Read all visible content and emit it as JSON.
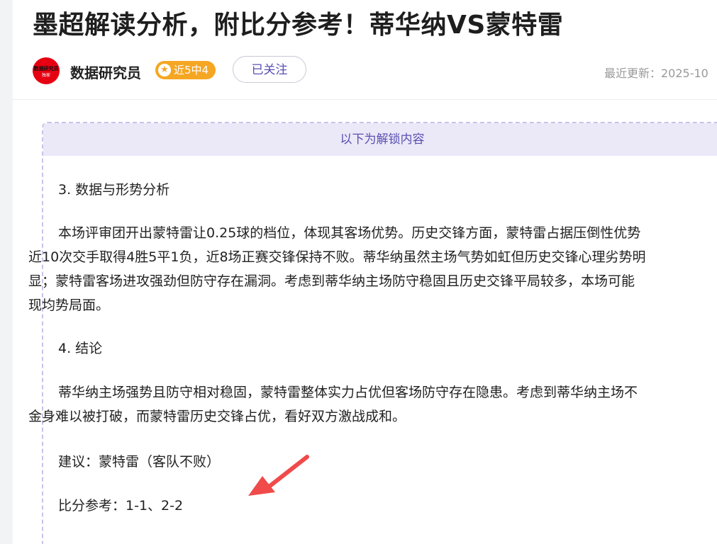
{
  "article": {
    "title": "墨超解读分析，附比分参考！蒂华纳VS蒙特雷"
  },
  "author": {
    "avatar_text_1": "数据研究员",
    "avatar_text_2": "独家",
    "name": "数据研究员",
    "badge": "近5中4",
    "badge_icon": "star-icon",
    "follow_label": "已关注",
    "update_time": "最近更新：2025-10"
  },
  "locked": {
    "header": "以下为解锁内容"
  },
  "content": {
    "section3_heading": "3. 数据与形势分析",
    "section3_lines": [
      "本场评审团开出蒙特雷让0.25球的档位，体现其客场优势。历史交锋方面，蒙特雷占据压倒性优势",
      "近10次交手取得4胜5平1负，近8场正赛交锋保持不败。蒂华纳虽然主场气势如虹但历史交锋心理劣势明",
      "显；蒙特雷客场进攻强劲但防守存在漏洞。考虑到蒂华纳主场防守稳固且历史交锋平局较多，本场可能",
      "现均势局面。"
    ],
    "section4_heading": "4. 结论",
    "section4_lines": [
      "蒂华纳主场强势且防守相对稳固，蒙特雷整体实力占优但客场防守存在隐患。考虑到蒂华纳主场不",
      "金身难以被打破，而蒙特雷历史交锋占优，看好双方激战成和。"
    ],
    "suggestion": "建议：蒙特雷（客队不败）",
    "score_ref": "比分参考：1-1、2-2"
  },
  "colors": {
    "accent": "#5a4fb3",
    "badge": "#f5a623",
    "arrow": "#f04a4a",
    "locked_bg": "#ebe8f8"
  }
}
